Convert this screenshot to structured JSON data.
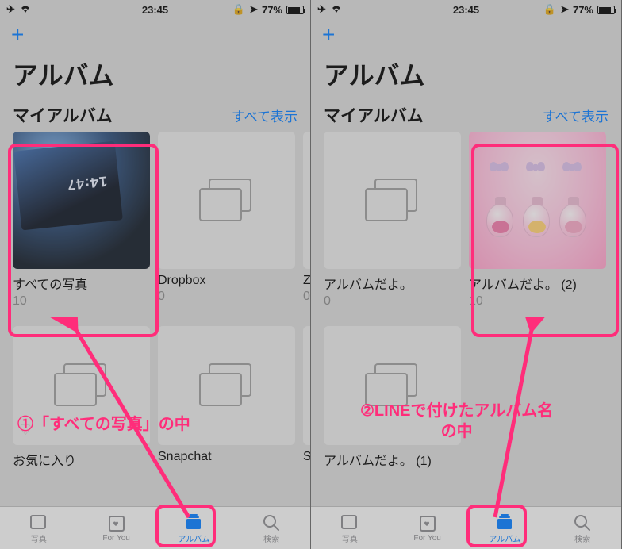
{
  "status": {
    "time": "23:45",
    "battery_pct": "77%"
  },
  "add_icon": "+",
  "page_title": "アルバム",
  "section": {
    "title": "マイアルバム",
    "show_all": "すべて表示"
  },
  "left": {
    "albums_row1": [
      {
        "name": "すべての写真",
        "count": "10"
      },
      {
        "name": "Dropbox",
        "count": "0"
      },
      {
        "name": "Z",
        "count": "0"
      }
    ],
    "albums_row2": [
      {
        "name": "お気に入り",
        "count": ""
      },
      {
        "name": "Snapchat",
        "count": ""
      },
      {
        "name": "S",
        "count": ""
      }
    ],
    "annotation": "①「すべての写真」の中"
  },
  "right": {
    "albums_row1": [
      {
        "name": "アルバムだよ。",
        "count": "0"
      },
      {
        "name": "アルバムだよ。 (2)",
        "count": "10"
      }
    ],
    "albums_row2": [
      {
        "name": "アルバムだよ。 (1)",
        "count": ""
      }
    ],
    "annotation": "②LINEで付けたアルバム名\nの中"
  },
  "tabs": {
    "photos": "写真",
    "for_you": "For You",
    "albums": "アルバム",
    "search": "検索"
  }
}
